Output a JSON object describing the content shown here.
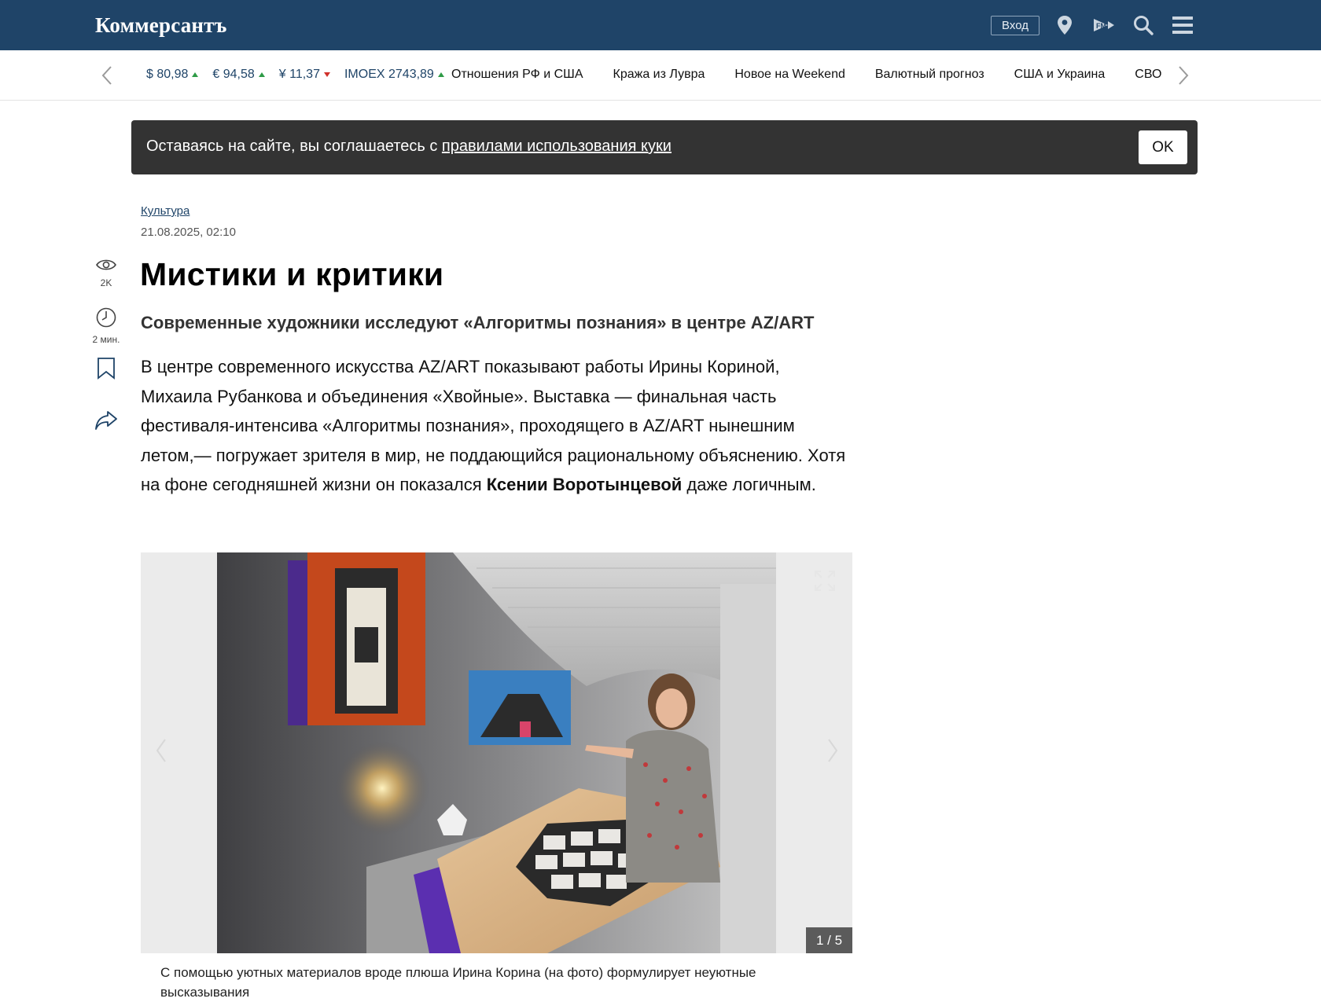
{
  "header": {
    "logo": "Коммерсантъ",
    "login_label": "Вход",
    "icons": [
      "location-icon",
      "fm-radio-icon",
      "search-icon",
      "menu-icon"
    ],
    "bg_color": "#1f4468"
  },
  "ticker": {
    "rates": [
      {
        "value": "$ 80,98",
        "trend": "up"
      },
      {
        "value": "€ 94,58",
        "trend": "up"
      },
      {
        "value": "¥ 11,37",
        "trend": "down"
      },
      {
        "value": "IMOEX 2743,89",
        "trend": "up"
      }
    ],
    "links": [
      "Отношения РФ и США",
      "Кража из Лувра",
      "Новое на Weekend",
      "Валютный прогноз",
      "США и Украина",
      "СВО"
    ]
  },
  "cookie": {
    "text": "Оставаясь на сайте, вы соглашаетесь с ",
    "link": "правилами использования куки",
    "ok": "OK"
  },
  "article": {
    "rubric": "Культура",
    "date": "21.08.2025, 02:10",
    "title": "Мистики и критики",
    "subtitle": "Современные художники исследуют «Алгоритмы познания» в центре AZ/ART",
    "lead_part1": "В центре современного искусства AZ/ART показывают работы Ирины Кориной, Михаила Рубанкова и объединения «Хвойные». Выставка — финальная часть фестиваля-интенсива «Алгоритмы познания», проходящего в AZ/ART нынешним летом,— погружает зрителя в мир, не поддающийся рациональному объяснению. Хотя на фоне сегодняшней жизни он показался ",
    "lead_bold": "Ксении Воротынцевой",
    "lead_part2": " даже логичным."
  },
  "tools": {
    "views": "2K",
    "read_time": "2 мин."
  },
  "gallery": {
    "counter": "1 / 5",
    "caption": "С помощью уютных материалов вроде плюша Ирина Корина (на фото) формулирует неуютные высказывания"
  }
}
